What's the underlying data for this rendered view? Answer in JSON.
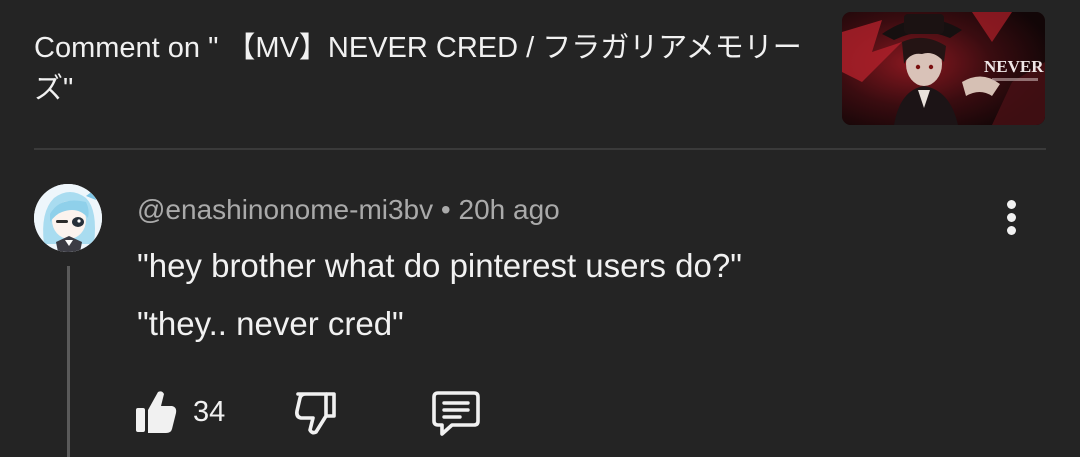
{
  "header": {
    "title": "Comment on \" 【MV】NEVER CRED / フラガリアメモリーズ\"",
    "thumbnail_text": "NEVER CRED"
  },
  "comment": {
    "author": "@enashinonome-mi3bv",
    "separator": "•",
    "time": "20h ago",
    "lines": [
      "\"hey brother what do pinterest users do?\"",
      "\"they.. never cred\""
    ]
  },
  "actions": {
    "like_count": "34"
  },
  "icons": {
    "like": "thumbs-up-icon",
    "dislike": "thumbs-down-icon",
    "reply": "reply-comment-icon",
    "more": "more-vertical-icon"
  },
  "colors": {
    "background": "#242424",
    "text_primary": "#f1f1f1",
    "text_secondary": "#aaaaaa",
    "divider": "#3a3a3a",
    "thread_line": "#5a5a5a"
  }
}
